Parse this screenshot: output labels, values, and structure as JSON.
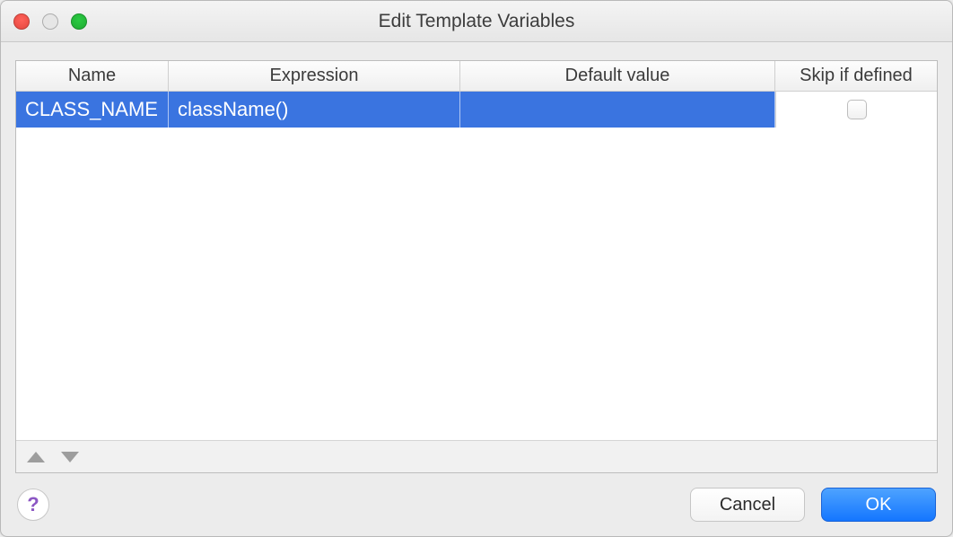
{
  "window": {
    "title": "Edit Template Variables"
  },
  "table": {
    "columns": {
      "name": "Name",
      "expression": "Expression",
      "default_value": "Default value",
      "skip": "Skip if defined"
    },
    "rows": [
      {
        "name": "CLASS_NAME",
        "expression": "className()",
        "default_value": "",
        "skip_if_defined": false,
        "selected": true
      }
    ]
  },
  "buttons": {
    "help": "?",
    "cancel": "Cancel",
    "ok": "OK"
  }
}
